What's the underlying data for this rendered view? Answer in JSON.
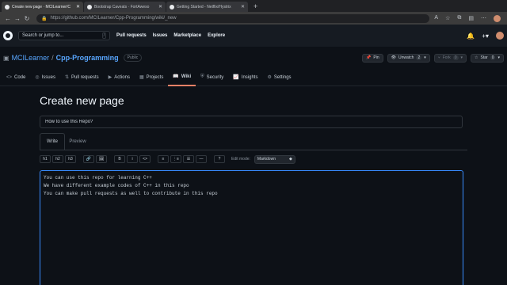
{
  "browser": {
    "tabs": [
      {
        "label": "Create new page · MCILearner/C"
      },
      {
        "label": "Bootstrap Caveats · FortAweso"
      },
      {
        "label": "Getting Started - Netflix/Hystrix"
      }
    ],
    "url": "https://github.com/MCILearner/Cpp-Programming/wiki/_new"
  },
  "header": {
    "search_placeholder": "Search or jump to...",
    "nav": [
      "Pull requests",
      "Issues",
      "Marketplace",
      "Explore"
    ]
  },
  "repo": {
    "owner": "MCILearner",
    "name": "Cpp-Programming",
    "visibility": "Public",
    "pin_label": "Pin",
    "unwatch_label": "Unwatch",
    "unwatch_count": "2",
    "fork_label": "Fork",
    "fork_count": "0",
    "star_label": "Star",
    "star_count": "0"
  },
  "repo_tabs": [
    "Code",
    "Issues",
    "Pull requests",
    "Actions",
    "Projects",
    "Wiki",
    "Security",
    "Insights",
    "Settings"
  ],
  "page": {
    "title": "Create new page",
    "page_title_value": "How to use this Repo?",
    "write_tab": "Write",
    "preview_tab": "Preview",
    "edit_mode_label": "Edit mode:",
    "edit_mode_value": "Markdown",
    "toolbar": [
      "h1",
      "h2",
      "h3",
      "🔗",
      "🖼",
      "B",
      "i",
      "<>",
      "≡",
      "⋮≡",
      "☰",
      "—",
      "?"
    ],
    "content_lines": [
      "You can use this repo for learning C++",
      "We have different example codes of C++ in this repo",
      "You can make pull requests as well to contribute in this repo"
    ]
  }
}
